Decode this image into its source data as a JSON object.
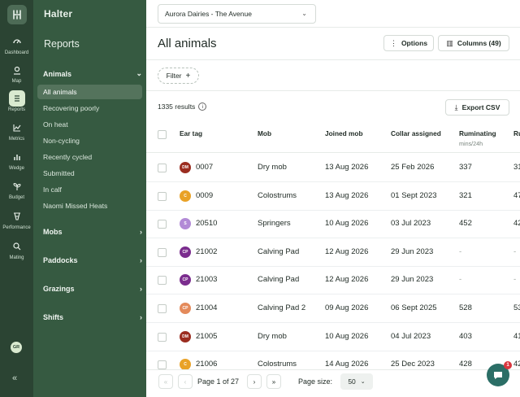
{
  "app": {
    "brand": "Halter"
  },
  "farm_selector": {
    "value": "Aurora Dairies - The Avenue"
  },
  "rail": {
    "items": [
      {
        "label": "Dashboard",
        "icon": "gauge-icon"
      },
      {
        "label": "Map",
        "icon": "map-pin-icon"
      },
      {
        "label": "Reports",
        "icon": "list-icon",
        "active": true
      },
      {
        "label": "Metrics",
        "icon": "line-chart-icon"
      },
      {
        "label": "Wedge",
        "icon": "bar-chart-icon"
      },
      {
        "label": "Budget",
        "icon": "sprout-icon"
      },
      {
        "label": "Performance",
        "icon": "cow-head-icon"
      },
      {
        "label": "Mating",
        "icon": "mating-icon"
      }
    ],
    "avatar": "GR"
  },
  "sidebar": {
    "section_title": "Reports",
    "animals_label": "Animals",
    "animal_items": [
      "All animals",
      "Recovering poorly",
      "On heat",
      "Non-cycling",
      "Recently cycled",
      "Submitted",
      "In calf",
      "Naomi Missed Heats"
    ],
    "groups": [
      "Mobs",
      "Paddocks",
      "Grazings",
      "Shifts"
    ]
  },
  "page": {
    "title": "All animals",
    "options_label": "Options",
    "columns_label": "Columns (49)",
    "filter_label": "Filter",
    "results_text": "1335 results",
    "export_label": "Export CSV"
  },
  "table": {
    "headers": {
      "ear_tag": "Ear tag",
      "mob": "Mob",
      "joined": "Joined mob",
      "collar": "Collar assigned",
      "ruminating": "Ruminating",
      "ruminating_sub": "mins/24h",
      "next": "Ru"
    },
    "rows": [
      {
        "initials": "DM",
        "color": "#9b2d20",
        "tag": "0007",
        "mob": "Dry mob",
        "joined": "13 Aug 2026",
        "collar": "25 Feb 2026",
        "rum": "337",
        "next": "31"
      },
      {
        "initials": "C",
        "color": "#e9a227",
        "tag": "0009",
        "mob": "Colostrums",
        "joined": "13 Aug 2026",
        "collar": "01 Sept 2023",
        "rum": "321",
        "next": "47"
      },
      {
        "initials": "S",
        "color": "#b28ad6",
        "tag": "20510",
        "mob": "Springers",
        "joined": "10 Aug 2026",
        "collar": "03 Jul 2023",
        "rum": "452",
        "next": "42"
      },
      {
        "initials": "CP",
        "color": "#7b2d8e",
        "tag": "21002",
        "mob": "Calving Pad",
        "joined": "12 Aug 2026",
        "collar": "29 Jun 2023",
        "rum": "-",
        "next": "-"
      },
      {
        "initials": "CP",
        "color": "#7b2d8e",
        "tag": "21003",
        "mob": "Calving Pad",
        "joined": "12 Aug 2026",
        "collar": "29 Jun 2023",
        "rum": "-",
        "next": "-"
      },
      {
        "initials": "CP",
        "color": "#e48a5b",
        "tag": "21004",
        "mob": "Calving Pad 2",
        "joined": "09 Aug 2026",
        "collar": "06 Sept 2025",
        "rum": "528",
        "next": "53"
      },
      {
        "initials": "DM",
        "color": "#9b2d20",
        "tag": "21005",
        "mob": "Dry mob",
        "joined": "10 Aug 2026",
        "collar": "04 Jul 2023",
        "rum": "403",
        "next": "41"
      },
      {
        "initials": "C",
        "color": "#e9a227",
        "tag": "21006",
        "mob": "Colostrums",
        "joined": "14 Aug 2026",
        "collar": "25 Dec 2023",
        "rum": "428",
        "next": "42"
      }
    ]
  },
  "pagination": {
    "page_text": "Page 1 of 27",
    "size_label": "Page size:",
    "size_value": "50"
  },
  "chat": {
    "badge": "1"
  }
}
